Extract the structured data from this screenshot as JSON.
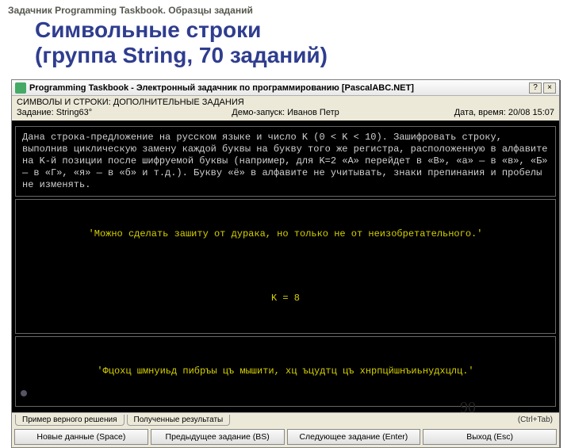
{
  "breadcrumb": "Задачник Programming Taskbook. Образцы заданий",
  "title_line1": "Символьные строки",
  "title_line2": "(группа String, 70 заданий)",
  "window": {
    "title": "Programming Taskbook - Электронный задачник по программированию [PascalABC.NET]",
    "help_btn": "?",
    "close_btn": "×",
    "section": "СИМВОЛЫ И СТРОКИ: ДОПОЛНИТЕЛЬНЫЕ ЗАДАНИЯ",
    "task_label": "Задание: String63°",
    "demo_label": "Демо-запуск: Иванов Петр",
    "date_label": "Дата, время: 20/08 15:07"
  },
  "terminal": {
    "problem": "Дана строка-предложение на русском языке и число K (0 < K < 10). Зашифровать строку, выполнив циклическую замену каждой буквы на букву того же регистра, расположенную в алфавите на K-й позиции после шифруемой буквы (например, для K=2 «А» перейдет в «В», «а» — в «в», «Б» — в «Г», «я» — в «б» и т.д.). Букву «ё» в алфавите не учитывать, знаки препинания и пробелы не изменять.",
    "input_line": "'Можно сделать зашиту от дурака, но только не от неизобретательного.'",
    "k_line": "K = 8",
    "output_line": "'Фцохц шмнуиьд пибръы цъ мышити, хц ъцудтц цъ хнрпцйшнъиьнудхцлц.'"
  },
  "tabs": {
    "t1": "Пример верного решения",
    "t2": "Полученные результаты",
    "hint": "(Ctrl+Tab)"
  },
  "buttons": {
    "b1": "Новые данные (Space)",
    "b2": "Предыдущее задание (BS)",
    "b3": "Следующее задание (Enter)",
    "b4": "Выход (Esc)"
  },
  "page_number": "90"
}
